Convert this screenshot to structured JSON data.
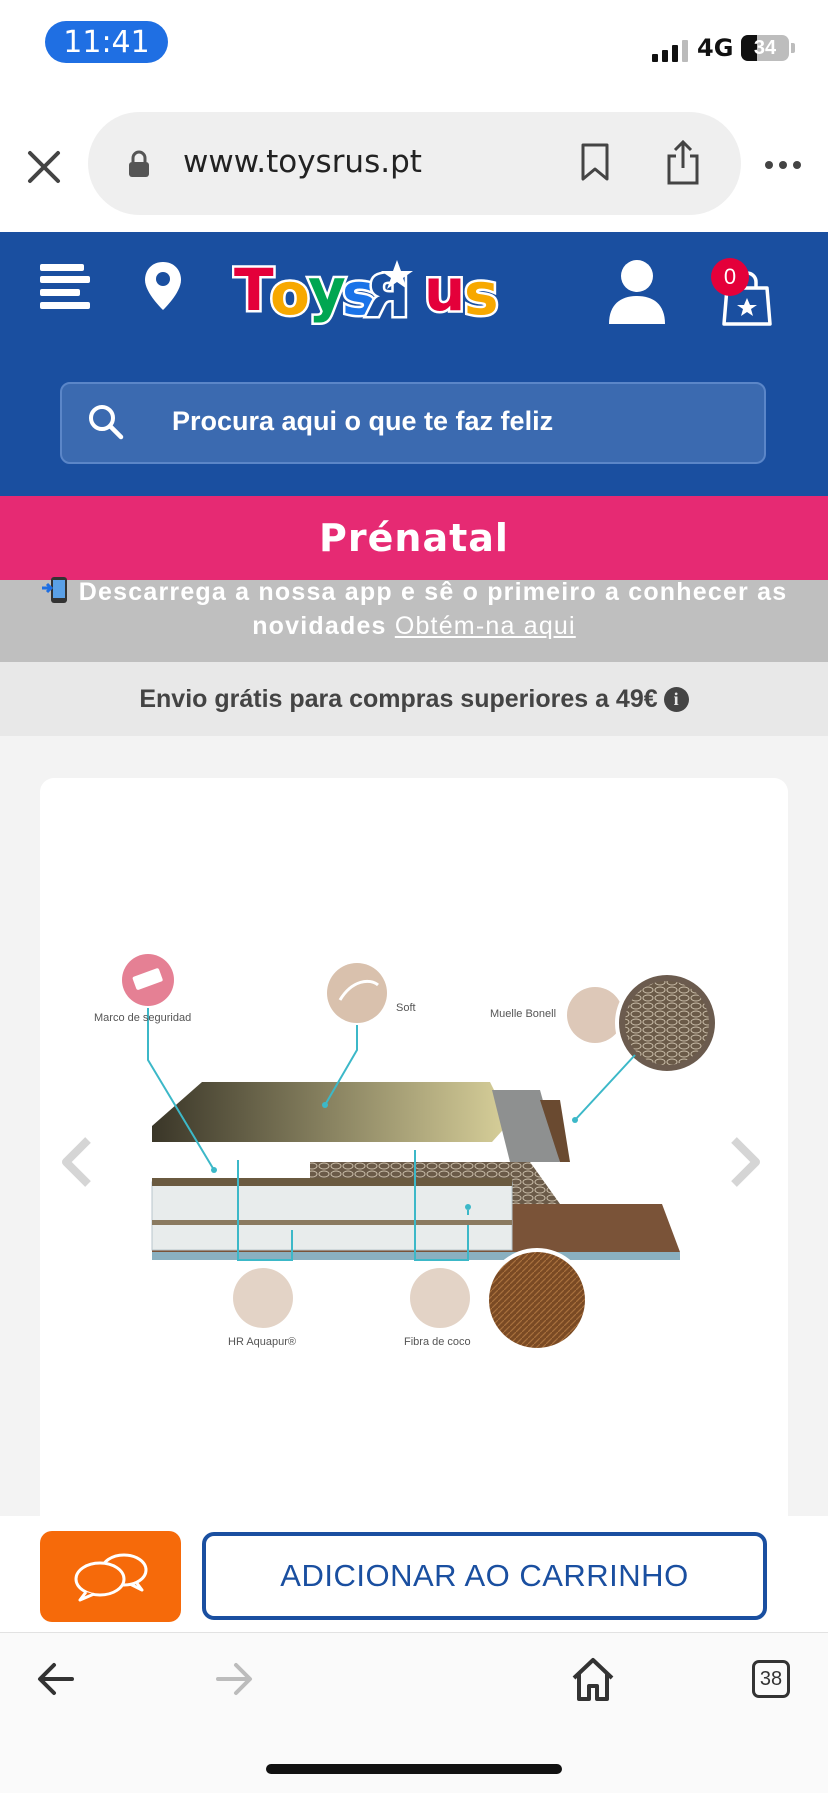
{
  "status_bar": {
    "time": "11:41",
    "network": "4G",
    "battery": "34",
    "battery_level": 0.34
  },
  "browser": {
    "url": "www.toysrus.pt",
    "tabs_count": "38"
  },
  "header": {
    "search_placeholder": "Procura aqui o que te faz feliz",
    "cart_count": "0",
    "brand_color": "#1a4fa0"
  },
  "prenatal_banner": {
    "label": "Prénatal",
    "color": "#e62a73"
  },
  "app_promo": {
    "text_line1": "Descarrega a nossa app e sê o primeiro a conhecer as",
    "text_line2": "novidades",
    "link": "Obtém-na aqui"
  },
  "shipping": {
    "text": "Envio grátis para compras superiores a 49€"
  },
  "product_image": {
    "labels": {
      "safety_frame": "Marco de seguridad",
      "soft": "Soft",
      "bonell_spring": "Muelle Bonell",
      "hr_foam": "HR Aquapur®",
      "coconut_fiber": "Fibra de coco"
    }
  },
  "actions": {
    "add_to_cart": "ADICIONAR AO CARRINHO",
    "chat_color": "#f66a0a"
  },
  "icons": [
    "close-icon",
    "lock-icon",
    "bookmark-icon",
    "share-icon",
    "more-icon",
    "menu-icon",
    "location-pin-icon",
    "user-icon",
    "shopping-bag-icon",
    "search-icon",
    "info-icon",
    "chevron-left-icon",
    "chevron-right-icon",
    "chat-icon",
    "back-arrow-icon",
    "forward-arrow-icon",
    "home-icon"
  ]
}
